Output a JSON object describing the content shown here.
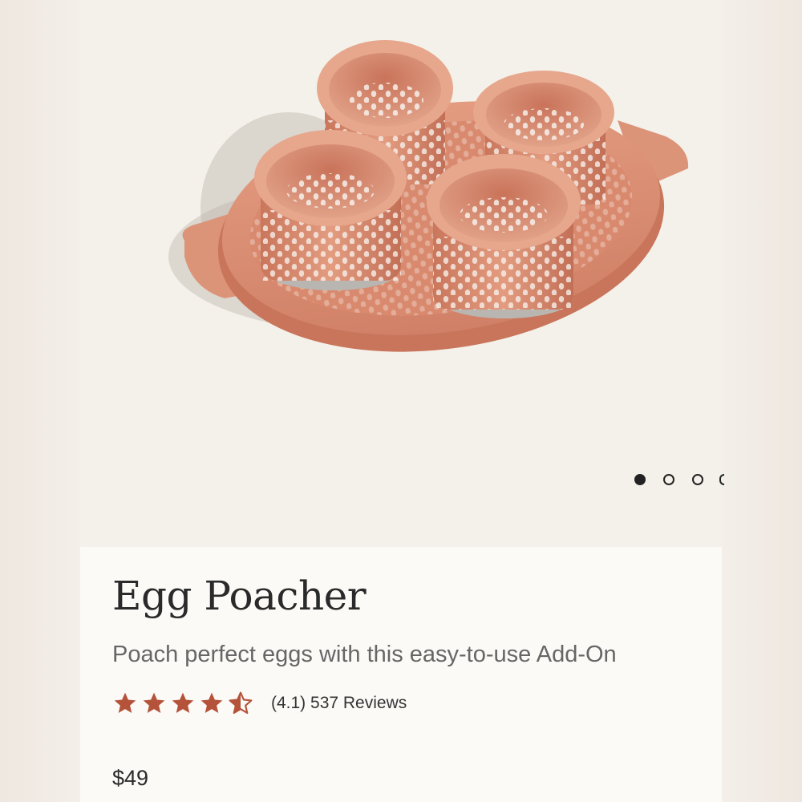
{
  "product": {
    "title": "Egg Poacher",
    "subtitle": "Poach perfect eggs with this easy-to-use Add-On",
    "rating": 4.1,
    "rating_text": "(4.1) 537 Reviews",
    "price": "$49",
    "image_icon": "egg-poacher-product-image"
  },
  "carousel": {
    "slides_visible": 4,
    "active_index": 0
  },
  "colors": {
    "accent_star": "#b5533a",
    "product_terracotta": "#d98d72",
    "dot": "#222222"
  }
}
